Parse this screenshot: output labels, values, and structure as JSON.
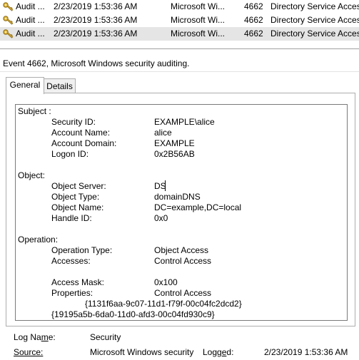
{
  "rows": [
    {
      "level": "Audit ...",
      "date": "2/23/2019 1:53:36 AM",
      "source": "Microsoft Wi...",
      "event_id": "4662",
      "category": "Directory Service Access",
      "selected": false
    },
    {
      "level": "Audit ...",
      "date": "2/23/2019 1:53:36 AM",
      "source": "Microsoft Wi...",
      "event_id": "4662",
      "category": "Directory Service Access",
      "selected": false
    },
    {
      "level": "Audit ...",
      "date": "2/23/2019 1:53:36 AM",
      "source": "Microsoft Wi...",
      "event_id": "4662",
      "category": "Directory Service Access",
      "selected": true
    }
  ],
  "event_title": "Event 4662, Microsoft Windows security auditing.",
  "tabs": {
    "general": "General",
    "details": "Details"
  },
  "details": {
    "subject_header": "Subject :",
    "security_id_label": "Security ID:",
    "security_id": "EXAMPLE\\alice",
    "account_name_label": "Account Name:",
    "account_name": "alice",
    "account_domain_label": "Account Domain:",
    "account_domain": "EXAMPLE",
    "logon_id_label": "Logon ID:",
    "logon_id": "0x2B56AB",
    "object_header": "Object:",
    "object_server_label": "Object Server:",
    "object_server": "DS",
    "object_type_label": "Object Type:",
    "object_type": "domainDNS",
    "object_name_label": "Object Name:",
    "object_name": "DC=example,DC=local",
    "handle_id_label": "Handle ID:",
    "handle_id": "0x0",
    "operation_header": "Operation:",
    "operation_type_label": "Operation Type:",
    "operation_type": "Object Access",
    "accesses_label": "Accesses:",
    "accesses": "Control Access",
    "access_mask_label": "Access Mask:",
    "access_mask": "0x100",
    "properties_label": "Properties:",
    "properties": "Control Access",
    "guid1": "{1131f6aa-9c07-11d1-f79f-00c04fc2dcd2}",
    "guid2": "{19195a5b-6da0-11d0-afd3-00c04fd930c9}"
  },
  "footer": {
    "log_name_label_pre": "Log Na",
    "log_name_label_u": "m",
    "log_name_label_post": "e:",
    "log_name": "Security",
    "source_label": "Source:",
    "source": "Microsoft Windows security",
    "logged_label_pre": "Logg",
    "logged_label_u": "e",
    "logged_label_post": "d:",
    "logged": "2/23/2019 1:53:36 AM"
  },
  "icons": {
    "row_icon": "key-icon"
  }
}
